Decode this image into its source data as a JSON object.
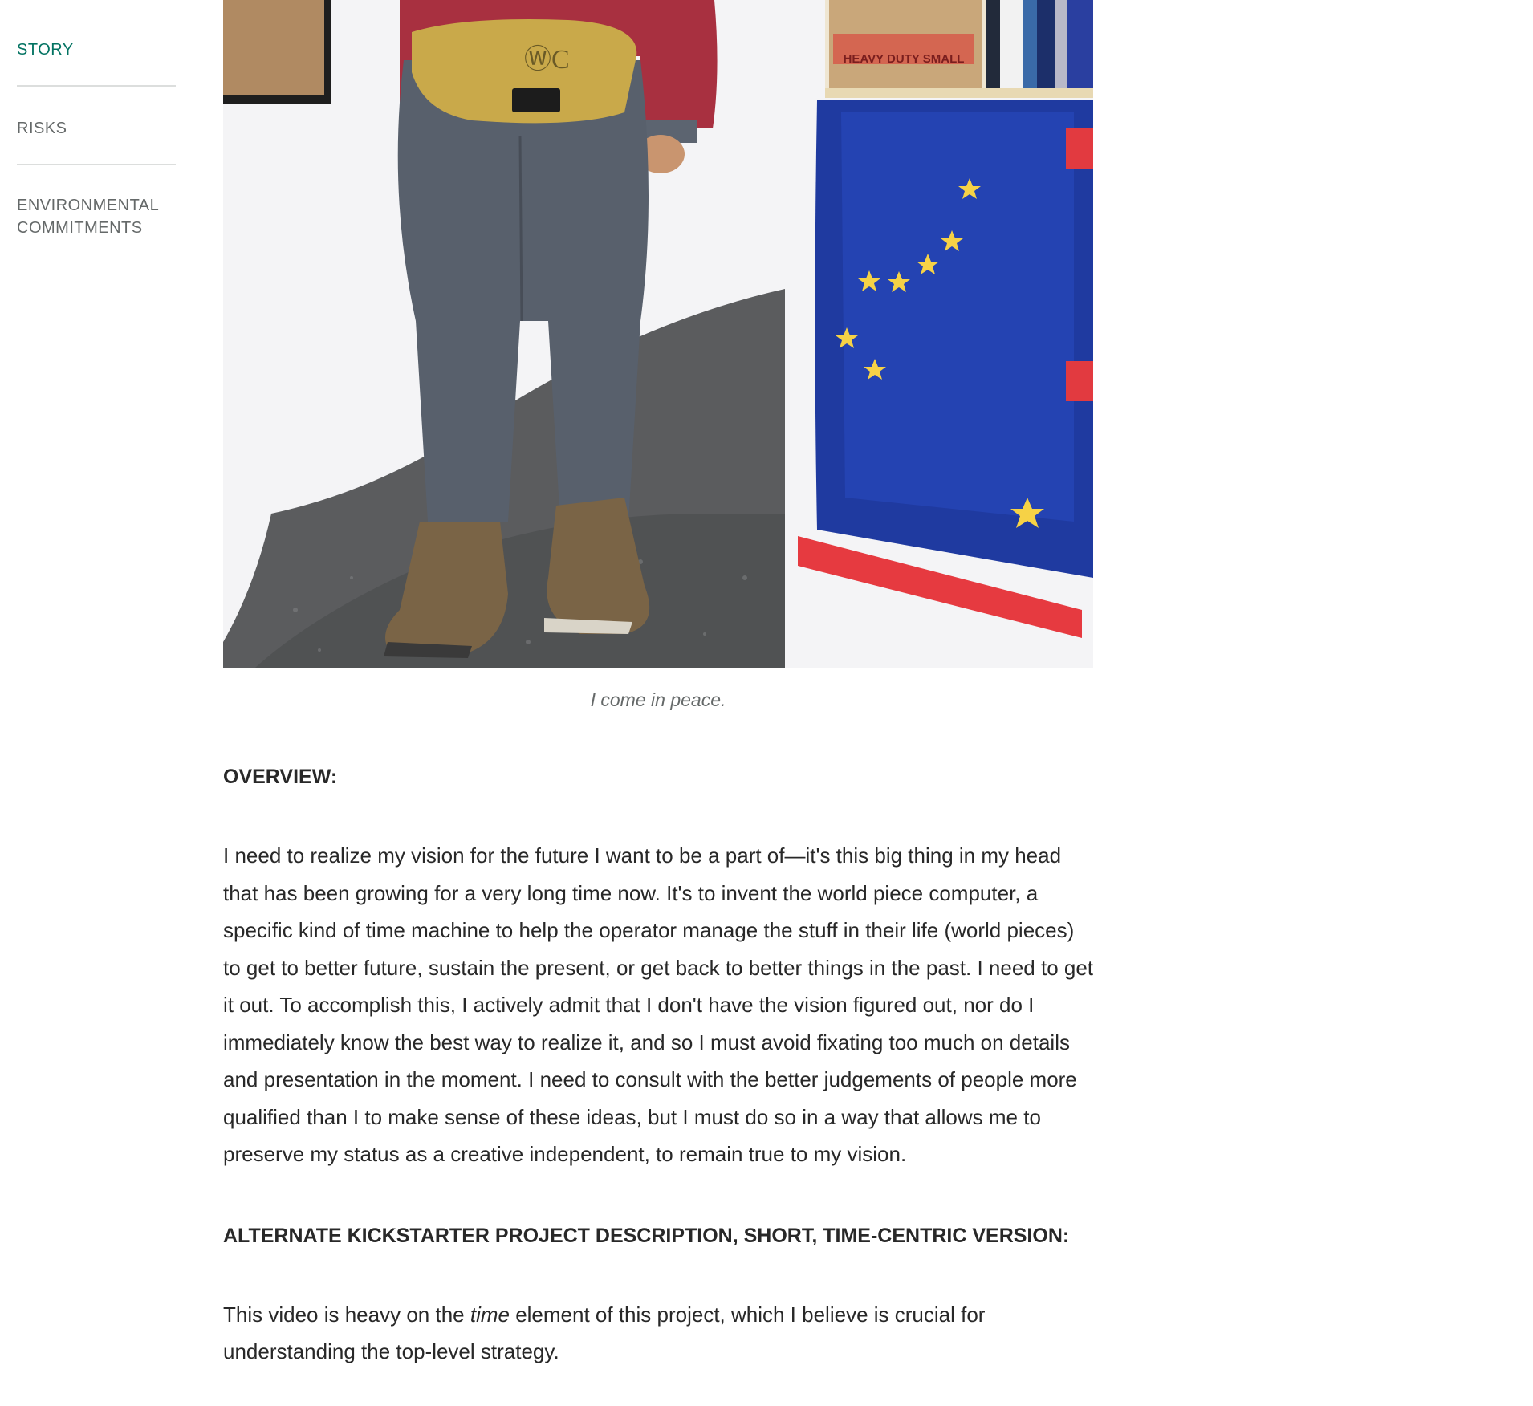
{
  "nav": {
    "items": [
      {
        "label": "STORY",
        "active": true
      },
      {
        "label": "RISKS",
        "active": false
      },
      {
        "label": "ENVIRONMENTAL COMMITMENTS",
        "active": false
      }
    ],
    "active_color": "#037362",
    "inactive_color": "#656969"
  },
  "hero": {
    "caption": "I come in peace.",
    "bag_logo": "ⓌC",
    "box_text": "HEAVY DUTY SMALL"
  },
  "sections": {
    "overview": {
      "heading": "OVERVIEW:",
      "body": "I need to realize my vision for the future I want to be a part of—it's this big thing in my head that has been growing for a very long time now. It's to invent the world piece computer, a specific kind of time machine to help the operator manage the stuff in their life (world pieces) to get to better future, sustain the present, or get back to better things in the past. I need to get it out. To accomplish this, I actively admit that I don't have the vision figured out, nor do I immediately know the best way to realize it, and so I must avoid fixating too much on details and presentation in the moment. I need to consult with the better judgements of people more qualified than I to make sense of these ideas, but I must do so in a way that allows me to preserve my status as a creative independent, to remain true to my vision."
    },
    "alternate": {
      "heading": "ALTERNATE KICKSTARTER PROJECT DESCRIPTION, SHORT, TIME-CENTRIC VERSION:",
      "body_before": "This video is heavy on the ",
      "body_emphasis": "time",
      "body_after": " element of this project, which I believe is crucial for understanding the top-level strategy."
    }
  }
}
